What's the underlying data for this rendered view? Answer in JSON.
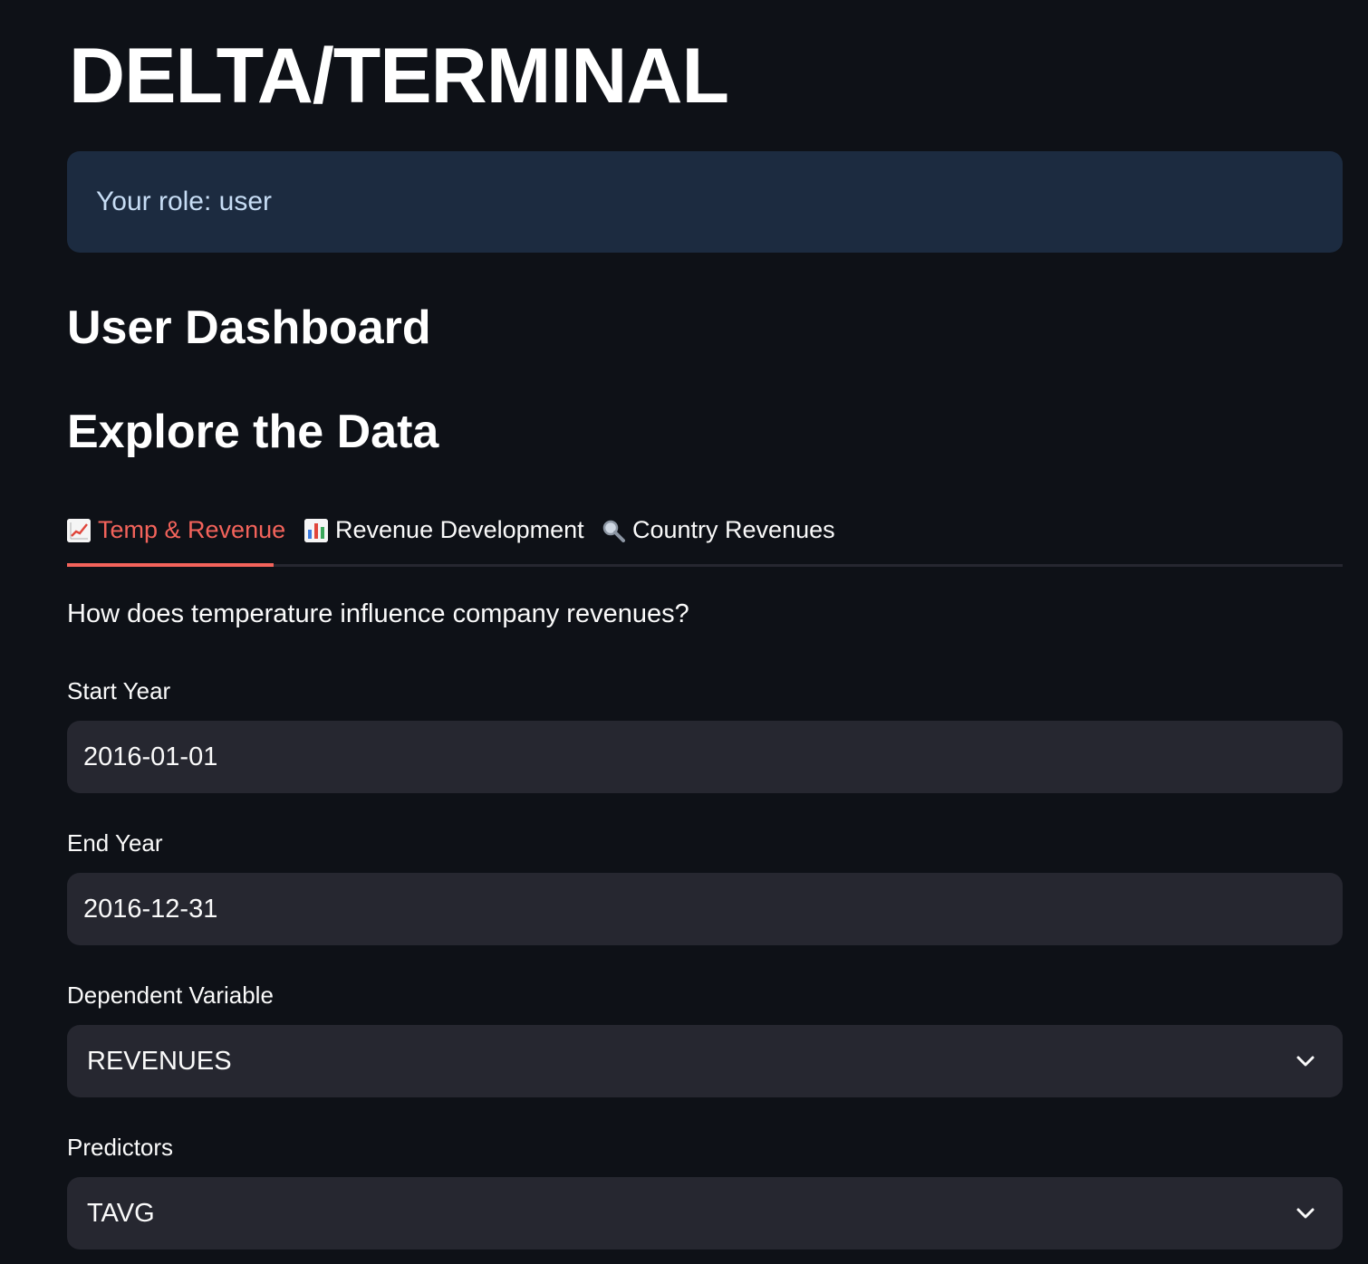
{
  "app": {
    "title": "DELTA/TERMINAL"
  },
  "info": {
    "text": "Your role: user"
  },
  "headings": {
    "dashboard": "User Dashboard",
    "explore": "Explore the Data"
  },
  "tabs": [
    {
      "icon": "chart-increasing-icon",
      "label": "Temp & Revenue",
      "active": true
    },
    {
      "icon": "bar-chart-icon",
      "label": "Revenue Development",
      "active": false
    },
    {
      "icon": "magnifying-glass-icon",
      "label": "Country Revenues",
      "active": false
    }
  ],
  "panel": {
    "question": "How does temperature influence company revenues?",
    "start_year": {
      "label": "Start Year",
      "value": "2016-01-01"
    },
    "end_year": {
      "label": "End Year",
      "value": "2016-12-31"
    },
    "dependent_variable": {
      "label": "Dependent Variable",
      "value": "REVENUES"
    },
    "predictors": {
      "label": "Predictors",
      "value": "TAVG"
    }
  },
  "colors": {
    "background": "#0e1117",
    "info_bg": "#1c2b40",
    "info_text": "#c7ddf5",
    "accent": "#f3635b",
    "field_bg": "#262730"
  }
}
